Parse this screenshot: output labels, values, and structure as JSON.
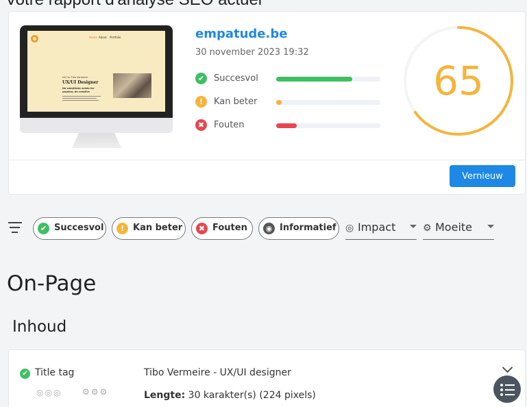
{
  "header_cut": "Votre rapport d'analyse SEO actuel",
  "report": {
    "site": "empatude.be",
    "date": "30 november 2023 19:32",
    "metrics": [
      {
        "label": "Succesvol",
        "color": "#3fbf63",
        "symbol": "✔",
        "fill": 0.73
      },
      {
        "label": "Kan beter",
        "color": "#f6b43a",
        "symbol": "!",
        "fill": 0.04
      },
      {
        "label": "Fouten",
        "color": "#e8464f",
        "symbol": "✖",
        "fill": 0.2
      }
    ],
    "score": "65",
    "score_fraction": 0.65,
    "refresh_label": "Vernieuw"
  },
  "screen_preview": {
    "nav": [
      "Home",
      "About",
      "Portfolio"
    ],
    "hero_small": "Hi! I'm Tibo Vermeire.",
    "hero_title": "UX/UI Designer",
    "hero_quote": "No substitute exists for passion; be creative"
  },
  "filters": {
    "chips": [
      {
        "label": "Succesvol",
        "color": "#3fbf63",
        "symbol": "✔"
      },
      {
        "label": "Kan beter",
        "color": "#f6b43a",
        "symbol": "!"
      },
      {
        "label": "Fouten",
        "color": "#e8464f",
        "symbol": "✖"
      },
      {
        "label": "Informatief",
        "color": "#555555",
        "symbol": "◉"
      }
    ],
    "impact_label": "Impact",
    "effort_label": "Moeite"
  },
  "section_title": "On-Page",
  "subsection_title": "Inhoud",
  "row": {
    "name": "Title tag",
    "value": "Tibo Vermeire - UX/UI designer",
    "length_label": "Lengte:",
    "length_value": "30 karakter(s) (224 pixels)",
    "impact_icons": "◎◎◎",
    "effort_icons": "⚙⚙⚙"
  },
  "colors": {
    "accent": "#1e88e5",
    "score": "#f6b43a",
    "success": "#3fbf63",
    "warning": "#f6b43a",
    "error": "#e8464f"
  }
}
